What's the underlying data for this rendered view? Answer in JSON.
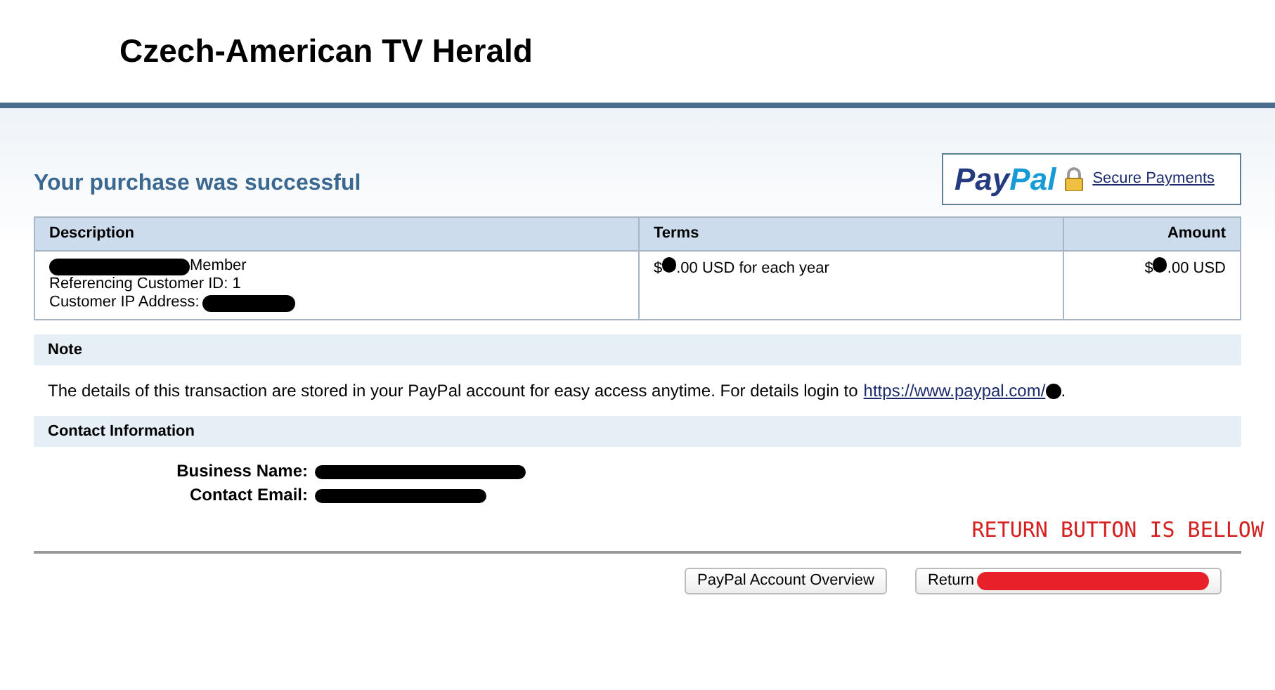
{
  "header": {
    "title": "Czech-American TV Herald"
  },
  "status": {
    "title": "Your purchase was successful"
  },
  "badge": {
    "logo_dark": "Pay",
    "logo_light": "Pal",
    "link": "Secure Payments"
  },
  "table": {
    "columns": [
      "Description",
      "Terms",
      "Amount"
    ],
    "row": {
      "description_suffix": "Member",
      "customer_id": "Referencing Customer ID: 1",
      "ip_label": "Customer IP Address:",
      "terms_prefix": "$",
      "terms_suffix": ".00 USD for each year",
      "amount_prefix": "$",
      "amount_suffix": ".00 USD"
    }
  },
  "note": {
    "heading": "Note",
    "text": "The details of this transaction are stored in your PayPal account for easy access anytime. For details login to",
    "link": "https://www.paypal.com/",
    "end": "."
  },
  "contact": {
    "heading": "Contact Information",
    "fields": [
      {
        "label": "Business Name:"
      },
      {
        "label": "Contact Email:"
      }
    ]
  },
  "annotation": "RETURN BUTTON IS BELLOW",
  "buttons": [
    {
      "label": "PayPal Account Overview",
      "kind": "plain"
    },
    {
      "label": "Return",
      "kind": "scribbled"
    }
  ]
}
